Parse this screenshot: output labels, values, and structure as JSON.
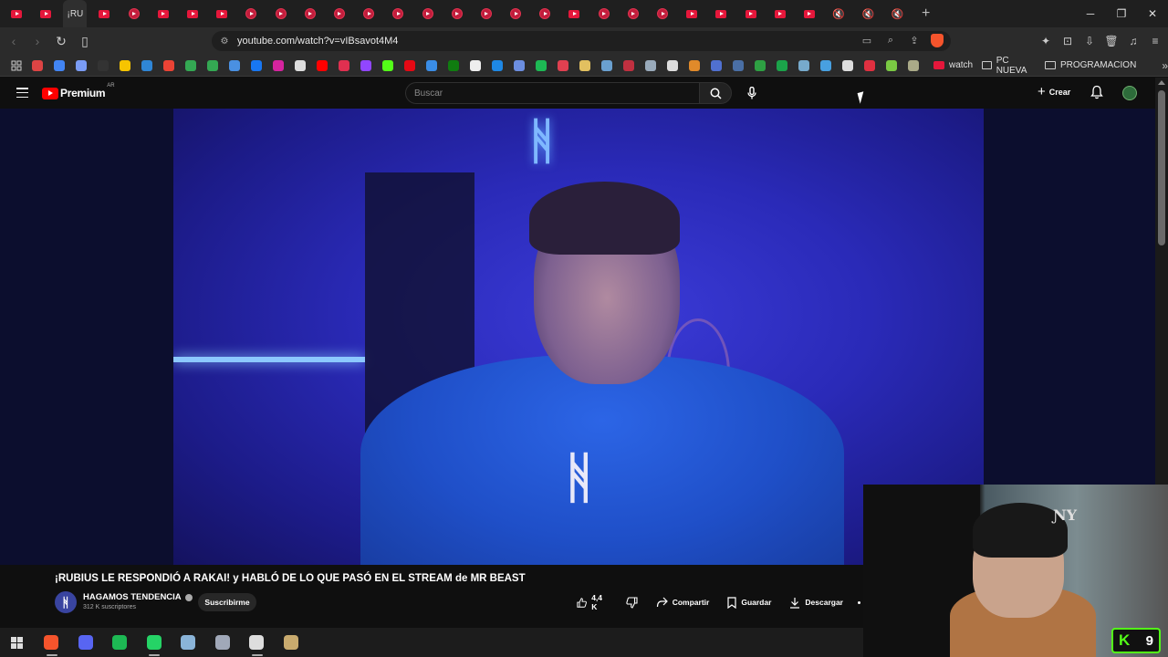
{
  "browser": {
    "active_tab_label": "¡RU",
    "tab_count_left": 2,
    "tab_count_right": 28,
    "url": "youtube.com/watch?v=vIBsavot4M4",
    "bookmarks": [
      {
        "icon": "bookmark-icon",
        "color": "#d44"
      },
      {
        "icon": "google-icon",
        "color": "#4285f4"
      },
      {
        "icon": "gemini-icon",
        "color": "#7a9cf5"
      },
      {
        "icon": "bookmark-icon",
        "color": "#333"
      },
      {
        "icon": "keep-icon",
        "color": "#f7c400"
      },
      {
        "icon": "onedrive-icon",
        "color": "#2f86d6"
      },
      {
        "icon": "gmail-icon",
        "color": "#ea4335"
      },
      {
        "icon": "drive-icon",
        "color": "#34a853"
      },
      {
        "icon": "maps-icon",
        "color": "#34a853"
      },
      {
        "icon": "globe-icon",
        "color": "#4a90e2"
      },
      {
        "icon": "facebook-icon",
        "color": "#1877f2"
      },
      {
        "icon": "instagram-icon",
        "color": "#d6249f"
      },
      {
        "icon": "x-icon",
        "color": "#ddd"
      },
      {
        "icon": "youtube-icon",
        "color": "#ff0000"
      },
      {
        "icon": "bookmark-icon",
        "color": "#e03050"
      },
      {
        "icon": "twitch-icon",
        "color": "#9146ff"
      },
      {
        "icon": "kick-icon",
        "color": "#53fc18"
      },
      {
        "icon": "netflix-icon",
        "color": "#e50914"
      },
      {
        "icon": "bookmark-icon",
        "color": "#3a8de6"
      },
      {
        "icon": "xbox-icon",
        "color": "#107c10"
      },
      {
        "icon": "bookmark-icon",
        "color": "#eee"
      },
      {
        "icon": "bookmark-icon",
        "color": "#1e88e5"
      },
      {
        "icon": "bookmark-icon",
        "color": "#6c8ee0"
      },
      {
        "icon": "bookmark-icon",
        "color": "#1db954"
      },
      {
        "icon": "bookmark-icon",
        "color": "#e04050"
      },
      {
        "icon": "bookmark-icon",
        "color": "#e2c060"
      },
      {
        "icon": "bookmark-icon",
        "color": "#6aa0d0"
      },
      {
        "icon": "bookmark-icon",
        "color": "#c03040"
      },
      {
        "icon": "steam-icon",
        "color": "#9ab"
      },
      {
        "icon": "github-icon",
        "color": "#ddd"
      },
      {
        "icon": "bookmark-icon",
        "color": "#e08a2a"
      },
      {
        "icon": "bookmark-icon",
        "color": "#5070d0"
      },
      {
        "icon": "bookmark-icon",
        "color": "#4a6fa5"
      },
      {
        "icon": "bookmark-icon",
        "color": "#2ea043"
      },
      {
        "icon": "bookmark-icon",
        "color": "#1ba34a"
      },
      {
        "icon": "bookmark-icon",
        "color": "#7ac"
      },
      {
        "icon": "bookmark-icon",
        "color": "#48a0e0"
      },
      {
        "icon": "bookmark-icon",
        "color": "#ddd"
      },
      {
        "icon": "bookmark-icon",
        "color": "#e03040"
      },
      {
        "icon": "bookmark-icon",
        "color": "#7ac943"
      },
      {
        "icon": "bookmark-icon",
        "color": "#aa8"
      }
    ],
    "bookmark_watch": "watch",
    "folder_pc": "PC NUEVA",
    "folder_prog": "PROGRAMACION"
  },
  "youtube": {
    "logo_word": "Premium",
    "region": "AR",
    "search_placeholder": "Buscar",
    "create_label": "Crear",
    "video_title": "¡RUBIUS LE RESPONDIÓ A RAKAI! y HABLÓ DE LO QUE PASÓ EN EL STREAM de MR BEAST",
    "channel_name": "HAGAMOS TENDENCIA",
    "subscribers": "312 K suscriptores",
    "subscribe_label": "Suscribirme",
    "likes": "4,4 K",
    "share_label": "Compartir",
    "save_label": "Guardar",
    "download_label": "Descargar"
  },
  "video_overlay": {
    "brand_glyph": "ᚻ"
  },
  "webcam": {
    "kick_letter": "K",
    "kick_count": "9"
  },
  "taskbar": {
    "apps": [
      {
        "icon": "windows-start-icon"
      },
      {
        "icon": "brave-icon",
        "color": "#f5542c",
        "running": true
      },
      {
        "icon": "discord-icon",
        "color": "#5865f2",
        "running": false
      },
      {
        "icon": "spotify-icon",
        "color": "#1db954",
        "running": false
      },
      {
        "icon": "whatsapp-icon",
        "color": "#25d366",
        "running": true
      },
      {
        "icon": "notepad-icon",
        "color": "#8ab4d8",
        "running": false
      },
      {
        "icon": "app-icon",
        "color": "#a0a8b8",
        "running": false
      },
      {
        "icon": "obs-icon",
        "color": "#ddd",
        "running": true
      },
      {
        "icon": "league-icon",
        "color": "#c8aa6e",
        "running": false
      }
    ]
  }
}
